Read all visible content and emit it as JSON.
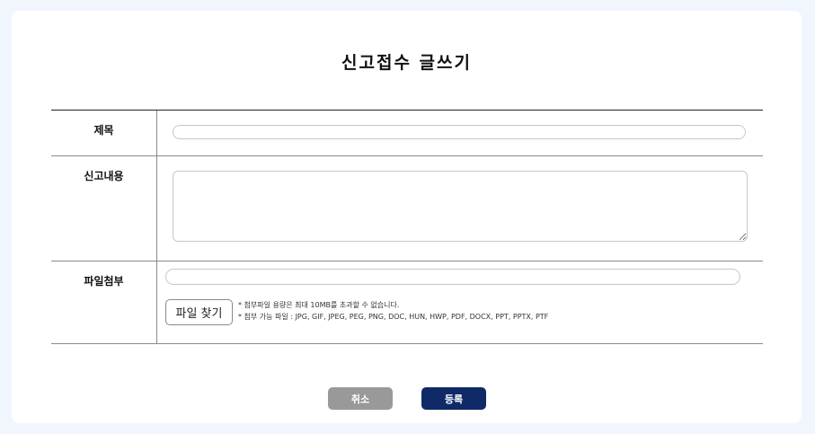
{
  "page": {
    "title": "신고접수 글쓰기"
  },
  "form": {
    "title_label": "제목",
    "title_value": "",
    "content_label": "신고내용",
    "content_value": "",
    "file_label": "파일첨부",
    "file_value": "",
    "file_button_label": "파일 찾기",
    "file_notes": [
      "* 첨부파일 용량은 최대 10MB를 초과할 수 없습니다.",
      "* 첨부 가능 파일 : JPG, GIF, JPEG, PEG, PNG, DOC, HUN, HWP, PDF, DOCX, PPT, PPTX, PTF"
    ]
  },
  "actions": {
    "cancel_label": "취소",
    "submit_label": "등록"
  },
  "colors": {
    "page_background": "#f1f6fe",
    "cancel_button": "#999999",
    "submit_button": "#102a68"
  }
}
